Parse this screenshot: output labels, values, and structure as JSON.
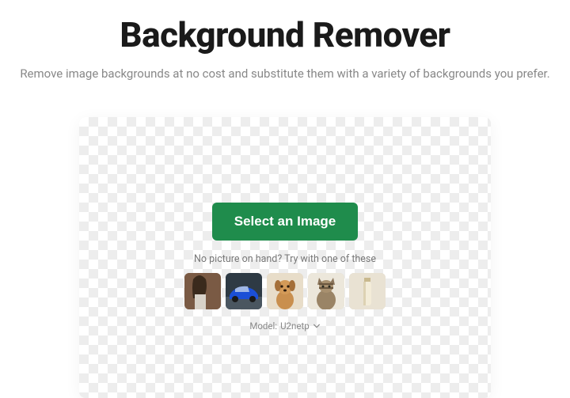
{
  "header": {
    "title": "Background Remover",
    "subtitle": "Remove image backgrounds at no cost and substitute them with a variety of backgrounds you prefer."
  },
  "upload": {
    "button_label": "Select an Image",
    "hint": "No picture on hand? Try with one of these"
  },
  "samples": [
    {
      "name": "woman-portrait"
    },
    {
      "name": "blue-car"
    },
    {
      "name": "golden-dog"
    },
    {
      "name": "tabby-cat"
    },
    {
      "name": "cosmetic-tube"
    }
  ],
  "model": {
    "label_prefix": "Model:",
    "value": "U2netp"
  },
  "colors": {
    "primary_button": "#1f8c4c"
  }
}
